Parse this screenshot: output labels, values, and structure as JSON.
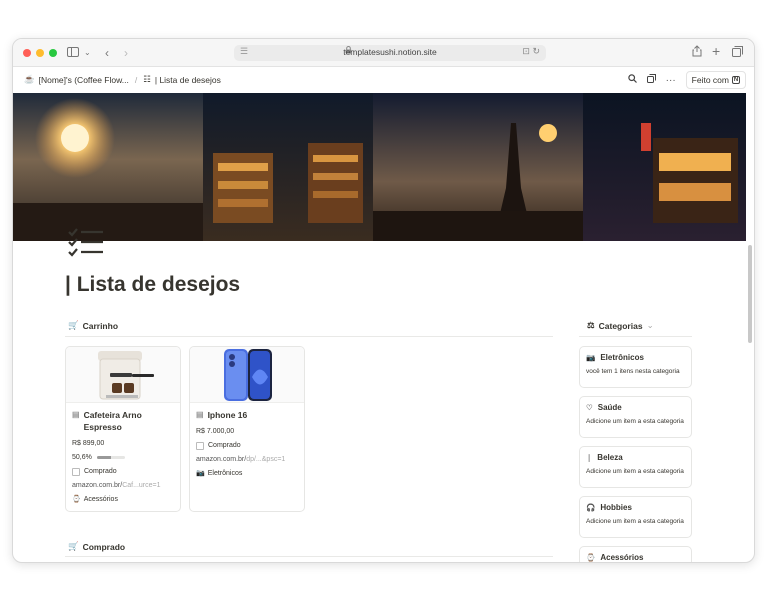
{
  "browser": {
    "url": "templatesushi.notion.site",
    "colors": {
      "close": "#ff5f57",
      "minimize": "#febc2e",
      "maximize": "#28c840"
    }
  },
  "notion": {
    "breadcrumb_parent": "[Nome]'s (Coffee Flow...",
    "breadcrumb_separator": "/",
    "breadcrumb_current": "| Lista de desejos",
    "made_with": "Feito com"
  },
  "page": {
    "title": "| Lista de desejos"
  },
  "cart": {
    "heading": "Carrinho",
    "items": [
      {
        "name": "Cafeteira Arno Espresso",
        "price": "R$ 899,00",
        "progress_label": "50,6%",
        "progress": 0.506,
        "checkbox_label": "Comprado",
        "link_main": "amazon.com.br/",
        "link_rest": "Caf...urce=1",
        "tag": "Acessórios"
      },
      {
        "name": "Iphone 16",
        "price": "R$ 7.000,00",
        "checkbox_label": "Comprado",
        "link_main": "amazon.com.br/",
        "link_rest": "dp/...&psc=1",
        "tag": "Eletrônicos"
      }
    ]
  },
  "purchased": {
    "heading": "Comprado"
  },
  "categories": {
    "heading": "Categorias",
    "items": [
      {
        "name": "Eletrônicos",
        "desc": "você tem 1 itens nesta categoria",
        "icon": "camera-icon"
      },
      {
        "name": "Saúde",
        "desc": "Adicione um item a esta categoria",
        "icon": "heart-icon"
      },
      {
        "name": "Beleza",
        "desc": "Adicione um item a esta categoria",
        "icon": "lipstick-icon"
      },
      {
        "name": "Hobbies",
        "desc": "Adicione um item a esta categoria",
        "icon": "headphones-icon"
      },
      {
        "name": "Acessórios",
        "desc": "",
        "icon": "watch-icon"
      }
    ]
  }
}
